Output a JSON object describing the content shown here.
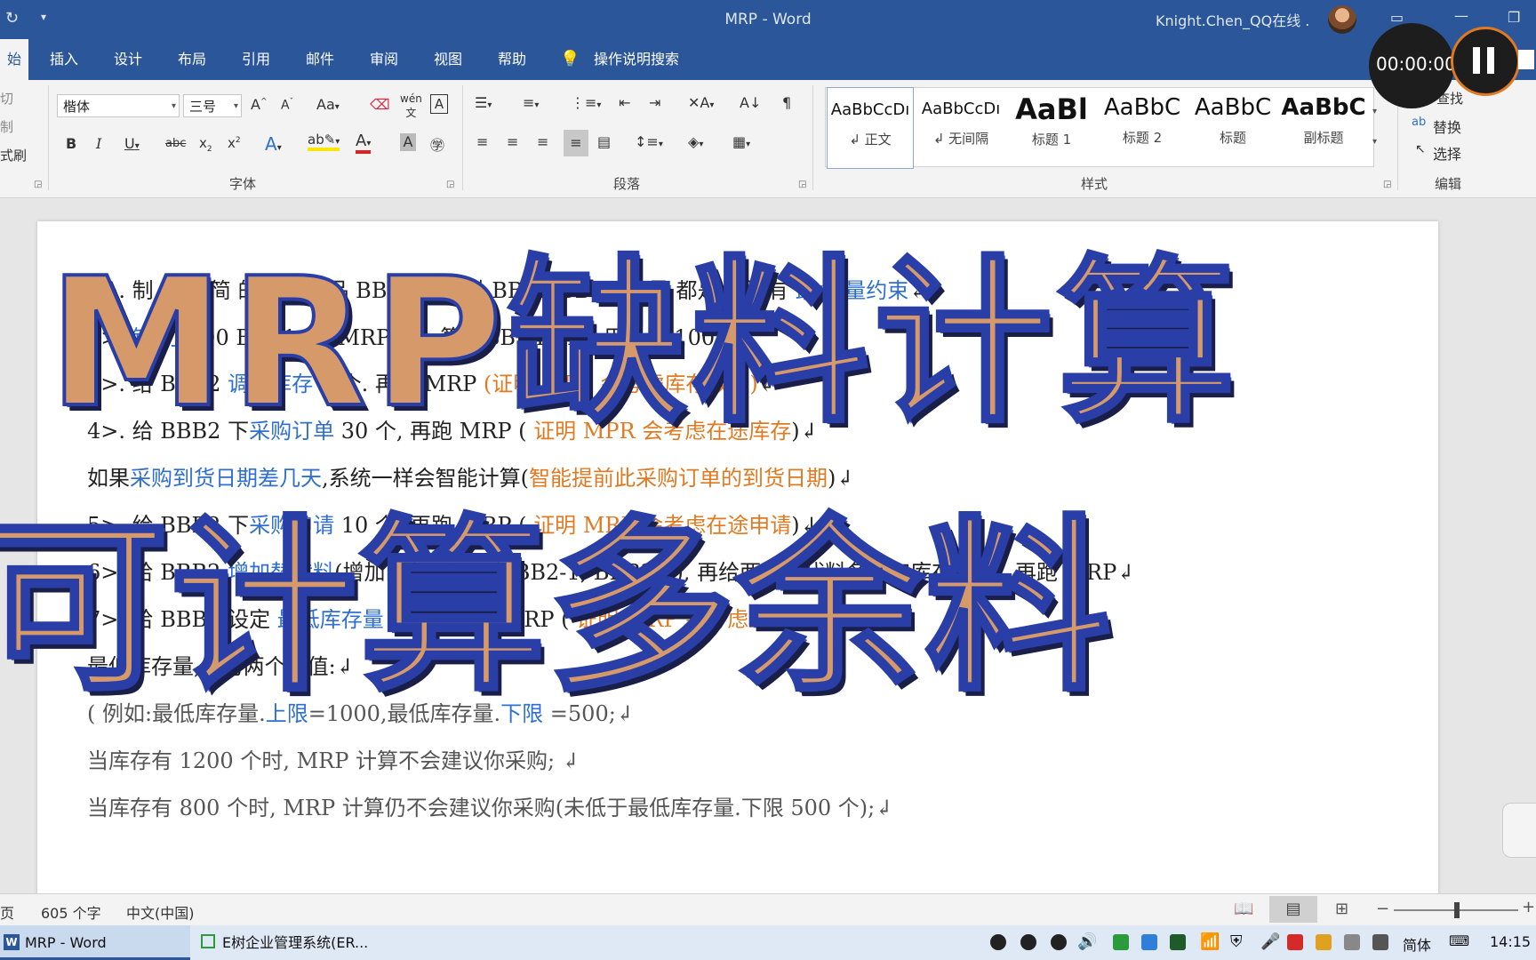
{
  "title_bar": {
    "window_title": "MRP  -  Word",
    "user": "Knight.Chen_QQ在线 ."
  },
  "tabs": [
    "始",
    "插入",
    "设计",
    "布局",
    "引用",
    "邮件",
    "审阅",
    "视图",
    "帮助"
  ],
  "tell_me": "操作说明搜索",
  "clipboard": {
    "cut": "切",
    "copy": "制",
    "format_painter": "式刷"
  },
  "font": {
    "family": "楷体",
    "size": "三号",
    "group_label": "字体",
    "wen_glyph": "wén",
    "aa_label": "Aa"
  },
  "paragraph": {
    "group_label": "段落"
  },
  "styles": {
    "group_label": "样式",
    "items": [
      {
        "preview": "AaBbCcDı",
        "name": "↲ 正文"
      },
      {
        "preview": "AaBbCcDı",
        "name": "↲ 无间隔"
      },
      {
        "preview": "AaBl",
        "name": "标题 1"
      },
      {
        "preview": "AaBbC",
        "name": "标题 2"
      },
      {
        "preview": "AaBbC",
        "name": "标题"
      },
      {
        "preview": "AaBbC",
        "name": "副标题"
      }
    ]
  },
  "editing": {
    "group_label": "编辑",
    "find": "查找",
    "replace": "替换",
    "select": "选择"
  },
  "recorder": {
    "timer": "00:00:00"
  },
  "document": {
    "lines": [
      {
        "parts": [
          {
            "t": "1>. 制  一个  简  的 "
          },
          {
            "t": "BO",
            "c": "blue"
          },
          {
            "t": "  产品  BB1 下   有   料 BBB2 BBB3  用量  都是 1   没有 "
          },
          {
            "t": "最小   量约束",
            "c": "blue"
          },
          {
            "t": "↲"
          }
        ]
      },
      {
        "parts": [
          {
            "t": "2>. "
          },
          {
            "t": "销  订",
            "c": "blue"
          },
          {
            "t": "  100  BBB1, 跑 MRP ( 计  算 BBB2,BBB3  用量各 100)↲"
          }
        ]
      },
      {
        "parts": [
          {
            "t": "3>. 给 BBB2 "
          },
          {
            "t": "调加库存",
            "c": "blue"
          },
          {
            "t": " 5 个. 再跑 MRP "
          },
          {
            "t": "(证明 MRP 会考虑库存数量)",
            "c": "orange"
          },
          {
            "t": "↲"
          }
        ]
      },
      {
        "parts": [
          {
            "t": "4>. 给 BBB2 下"
          },
          {
            "t": "采购订单",
            "c": "blue"
          },
          {
            "t": " 30 个, 再跑 MRP ( "
          },
          {
            "t": "证明 MPR 会考虑在途库存",
            "c": "orange"
          },
          {
            "t": ")↲"
          }
        ]
      },
      {
        "parts": [
          {
            "t": "    如果"
          },
          {
            "t": "采购到货日期差几天",
            "c": "blue"
          },
          {
            "t": ",系统一样会智能计算("
          },
          {
            "t": "智能提前此采购订单的到货日期",
            "c": "orange"
          },
          {
            "t": ")↲"
          }
        ]
      },
      {
        "parts": [
          {
            "t": "5>. 给 BBB2 下"
          },
          {
            "t": "采购申请",
            "c": "blue"
          },
          {
            "t": " 10 个, 再跑 MRP ( "
          },
          {
            "t": "证明 MRP 会考虑在途申请",
            "c": "orange"
          },
          {
            "t": ")↲"
          }
        ]
      },
      {
        "parts": [
          {
            "t": "6>. 给 BBB2 "
          },
          {
            "t": "增加替代料",
            "c": "blue"
          },
          {
            "t": "(增加两个替代料 BBB2-1, BBB2-2), 再给两个替代料各调加库存 5 个, 再跑 MRP↲"
          }
        ]
      },
      {
        "parts": [
          {
            "t": "7>. 给 BBB2 设定 "
          },
          {
            "t": "最低库存量",
            "c": "blue"
          },
          {
            "t": " 20 个,再跑 MRP ( "
          },
          {
            "t": "证明 MRP 会考虑最低库存量",
            "c": "orange"
          },
          {
            "t": ")↲"
          }
        ]
      },
      {
        "parts": [
          {
            "t": "    最低库存量,分为两个数值:↲"
          }
        ]
      },
      {
        "parts": [
          {
            "t": "  ( 例如:最低库存量.",
            "c": "gray"
          },
          {
            "t": "上限",
            "c": "blue"
          },
          {
            "t": "=1000,最低库存量.",
            "c": "gray"
          },
          {
            "t": "下限",
            "c": "blue"
          },
          {
            "t": " =500;↲",
            "c": "gray"
          }
        ]
      },
      {
        "parts": [
          {
            "t": "    当库存有 1200 个时, MRP 计算不会建议你采购; ↲",
            "c": "gray"
          }
        ]
      },
      {
        "parts": [
          {
            "t": "    当库存有 800 个时, MRP 计算仍不会建议你采购(未低于最低库存量.下限 500 个);↲",
            "c": "gray"
          }
        ]
      }
    ]
  },
  "overlay": {
    "line1": "MRP缺料计算",
    "line2": "可计算多余料"
  },
  "status_bar": {
    "page": "页",
    "word_count": "605 个字",
    "language": "中文(中国)"
  },
  "taskbar": {
    "items": [
      {
        "label": "MRP - Word"
      },
      {
        "label": "E树企业管理系统(ER..."
      }
    ],
    "ime": "简体",
    "time": "14:15"
  }
}
